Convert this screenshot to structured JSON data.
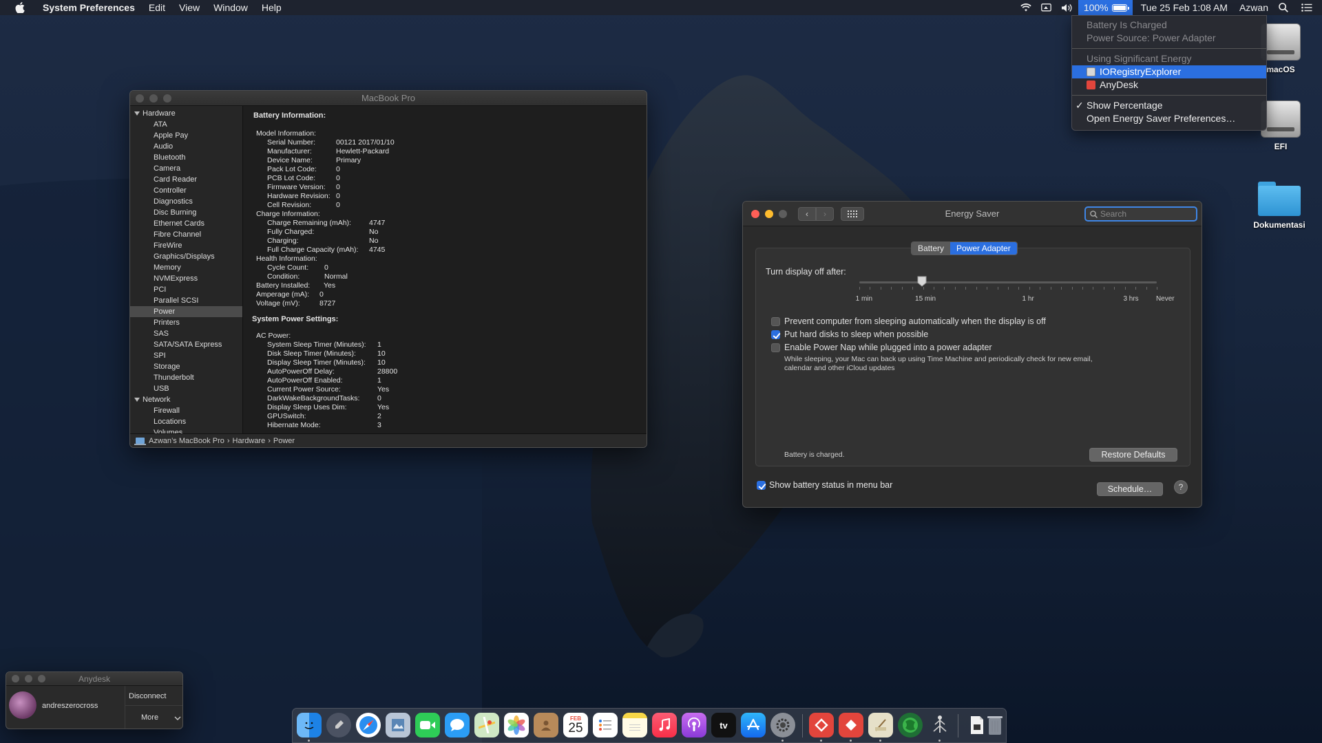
{
  "menubar": {
    "app_name": "System Preferences",
    "menus": [
      "Edit",
      "View",
      "Window",
      "Help"
    ],
    "battery_percent": "100%",
    "datetime": "Tue 25 Feb  1:08 AM",
    "user": "Azwan"
  },
  "battery_menu": {
    "status": "Battery Is Charged",
    "source": "Power Source: Power Adapter",
    "energy_header": "Using Significant Energy",
    "apps": [
      "IORegistryExplorer",
      "AnyDesk"
    ],
    "show_percentage": "Show Percentage",
    "open_prefs": "Open Energy Saver Preferences…"
  },
  "desktop_icons": {
    "macos": "macOS",
    "efi": "EFI",
    "dokumentasi": "Dokumentasi"
  },
  "sysinfo": {
    "title": "MacBook Pro",
    "hardware_header": "Hardware",
    "hardware_items": [
      "ATA",
      "Apple Pay",
      "Audio",
      "Bluetooth",
      "Camera",
      "Card Reader",
      "Controller",
      "Diagnostics",
      "Disc Burning",
      "Ethernet Cards",
      "Fibre Channel",
      "FireWire",
      "Graphics/Displays",
      "Memory",
      "NVMExpress",
      "PCI",
      "Parallel SCSI",
      "Power",
      "Printers",
      "SAS",
      "SATA/SATA Express",
      "SPI",
      "Storage",
      "Thunderbolt",
      "USB"
    ],
    "network_header": "Network",
    "network_items": [
      "Firewall",
      "Locations",
      "Volumes"
    ],
    "battery_info_header": "Battery Information:",
    "battery_lines": [
      {
        "k": "Model Information:",
        "v": "",
        "indent": 1
      },
      {
        "k": "Serial Number:",
        "v": "00121 2017/01/10",
        "indent": 2
      },
      {
        "k": "Manufacturer:",
        "v": "Hewlett-Packard",
        "indent": 2
      },
      {
        "k": "Device Name:",
        "v": "Primary",
        "indent": 2
      },
      {
        "k": "Pack Lot Code:",
        "v": "0",
        "indent": 2
      },
      {
        "k": "PCB Lot Code:",
        "v": "0",
        "indent": 2
      },
      {
        "k": "Firmware Version:",
        "v": "0",
        "indent": 2
      },
      {
        "k": "Hardware Revision:",
        "v": "0",
        "indent": 2
      },
      {
        "k": "Cell Revision:",
        "v": "0",
        "indent": 2
      },
      {
        "k": "Charge Information:",
        "v": "",
        "indent": 1
      },
      {
        "k": "Charge Remaining (mAh):",
        "v": "4747",
        "indent": 2
      },
      {
        "k": "Fully Charged:",
        "v": "No",
        "indent": 2
      },
      {
        "k": "Charging:",
        "v": "No",
        "indent": 2
      },
      {
        "k": "Full Charge Capacity (mAh):",
        "v": "4745",
        "indent": 2
      },
      {
        "k": "Health Information:",
        "v": "",
        "indent": 1
      },
      {
        "k": "Cycle Count:",
        "v": "0",
        "indent": 2
      },
      {
        "k": "Condition:",
        "v": "Normal",
        "indent": 2
      },
      {
        "k": "Battery Installed:",
        "v": "Yes",
        "indent": 1
      },
      {
        "k": "Amperage (mA):",
        "v": "0",
        "indent": 1
      },
      {
        "k": "Voltage (mV):",
        "v": "8727",
        "indent": 1
      }
    ],
    "power_settings_header": "System Power Settings:",
    "power_lines": [
      {
        "k": "AC Power:",
        "v": "",
        "indent": 1
      },
      {
        "k": "System Sleep Timer (Minutes):",
        "v": "1",
        "indent": 2
      },
      {
        "k": "Disk Sleep Timer (Minutes):",
        "v": "10",
        "indent": 2
      },
      {
        "k": "Display Sleep Timer (Minutes):",
        "v": "10",
        "indent": 2
      },
      {
        "k": "AutoPowerOff Delay:",
        "v": "28800",
        "indent": 2
      },
      {
        "k": "AutoPowerOff Enabled:",
        "v": "1",
        "indent": 2
      },
      {
        "k": "Current Power Source:",
        "v": "Yes",
        "indent": 2
      },
      {
        "k": "DarkWakeBackgroundTasks:",
        "v": "0",
        "indent": 2
      },
      {
        "k": "Display Sleep Uses Dim:",
        "v": "Yes",
        "indent": 2
      },
      {
        "k": "GPUSwitch:",
        "v": "2",
        "indent": 2
      },
      {
        "k": "Hibernate Mode:",
        "v": "3",
        "indent": 2
      }
    ],
    "breadcrumb": [
      "Azwan’s MacBook Pro",
      "Hardware",
      "Power"
    ]
  },
  "energy": {
    "title": "Energy Saver",
    "search_placeholder": "Search",
    "tabs": [
      "Battery",
      "Power Adapter"
    ],
    "active_tab": "Power Adapter",
    "turn_display_off_label": "Turn display off after:",
    "slider_ticks": [
      "1 min",
      "15 min",
      "1 hr",
      "3 hrs",
      "Never"
    ],
    "display_sleep_fraction": 0.21,
    "options": [
      {
        "label": "Prevent computer from sleeping automatically when the display is off",
        "checked": false
      },
      {
        "label": "Put hard disks to sleep when possible",
        "checked": true
      },
      {
        "label": "Enable Power Nap while plugged into a power adapter",
        "checked": false
      }
    ],
    "power_nap_desc_1": "While sleeping, your Mac can back up using Time Machine and periodically check for new email,",
    "power_nap_desc_2": "calendar and other iCloud updates",
    "battery_status": "Battery is charged.",
    "restore_defaults": "Restore Defaults",
    "show_battery_status": "Show battery status in menu bar",
    "show_battery_checked": true,
    "schedule": "Schedule…",
    "help": "?"
  },
  "anydesk": {
    "title": "Anydesk",
    "user": "andreszerocross",
    "disconnect": "Disconnect",
    "more": "More"
  },
  "dock": {
    "calendar_month": "FEB",
    "calendar_day": "25",
    "tv_label": "tv"
  },
  "colors": {
    "accent": "#2b6fe0",
    "close": "#ff5f57",
    "minimize": "#febc2e"
  }
}
